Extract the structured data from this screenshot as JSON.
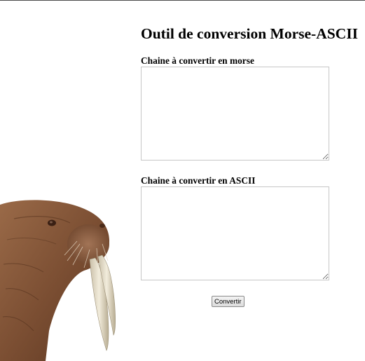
{
  "page": {
    "title": "Outil de conversion Morse-ASCII"
  },
  "form": {
    "morse_label": "Chaine à convertir en morse",
    "morse_value": "",
    "ascii_label": "Chaine à convertir en ASCII",
    "ascii_value": "",
    "convert_button_label": "Convertir"
  },
  "colors": {
    "background": "#ffffff",
    "textarea_border": "#c6c6c6",
    "walrus_skin": "#8a5a3c",
    "tusk": "#e8e0cc"
  },
  "images": {
    "mascot": "walrus-image"
  }
}
